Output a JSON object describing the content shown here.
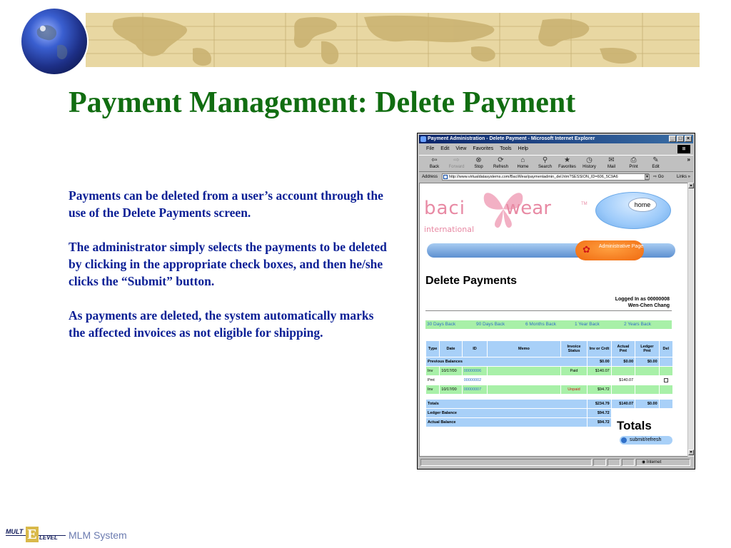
{
  "slide": {
    "title": "Payment Management: Delete Payment",
    "paragraphs": [
      "Payments can be deleted from a user’s account through the use of the Delete Payments screen.",
      "The administrator simply selects the payments to be deleted by clicking in the appropriate check boxes, and then he/she clicks the “Submit” button.",
      "As payments are deleted, the system automatically marks the affected invoices as not eligible for shipping."
    ],
    "footer_text": "MLM System",
    "logo": {
      "mult": "MULT",
      "e": "E",
      "level": "LEVEL"
    }
  },
  "browser": {
    "title": "Payment Administration - Delete Payment - Microsoft Internet Explorer",
    "menu": [
      "File",
      "Edit",
      "View",
      "Favorites",
      "Tools",
      "Help"
    ],
    "toolbar": [
      {
        "label": "Back",
        "icon": "back-arrow-icon",
        "enabled": true
      },
      {
        "label": "Forward",
        "icon": "forward-arrow-icon",
        "enabled": false
      },
      {
        "label": "Stop",
        "icon": "stop-icon",
        "enabled": true
      },
      {
        "label": "Refresh",
        "icon": "refresh-icon",
        "enabled": true
      },
      {
        "label": "Home",
        "icon": "home-icon",
        "enabled": true
      },
      {
        "label": "Search",
        "icon": "search-icon",
        "enabled": true
      },
      {
        "label": "Favorites",
        "icon": "favorites-icon",
        "enabled": true
      },
      {
        "label": "History",
        "icon": "history-icon",
        "enabled": true
      },
      {
        "label": "Mail",
        "icon": "mail-icon",
        "enabled": true
      },
      {
        "label": "Print",
        "icon": "print-icon",
        "enabled": true
      },
      {
        "label": "Edit",
        "icon": "edit-icon",
        "enabled": true
      }
    ],
    "address_label": "Address",
    "url": "http://www.virtualdatasystems.com/BaciWear/paymentadmin_del.htm?SESSION_ID=606_5C9A6",
    "go_label": "Go",
    "links_label": "Links",
    "status_zone": "Internet"
  },
  "page": {
    "brand_left": "baci",
    "brand_right": "wear",
    "brand_tm": "TM",
    "brand_sub": "international",
    "home_label": "home",
    "admin_label": "Administrative Page",
    "heading": "Delete Payments",
    "logged_in_line": "Logged In as 00000008",
    "user_name": "Wen-Chen Chang",
    "periods": [
      "30 Days Back",
      "90 Days Back",
      "6 Months Back",
      "1 Year Back",
      "2 Years Back"
    ],
    "table": {
      "headers": [
        "Type",
        "Date",
        "ID",
        "Memo",
        "Invoice Status",
        "Inv or Crdt",
        "Actual Pmt",
        "Ledger Pmt",
        "Del"
      ],
      "previous_balances": {
        "label": "Previous Balances",
        "inv": "$0.00",
        "actual": "$0.00",
        "ledger": "$0.00"
      },
      "rows": [
        {
          "type": "Inv",
          "date": "10/17/00",
          "id": "00000006",
          "memo": "",
          "status": "Paid",
          "inv": "$140.07",
          "actual": "",
          "ledger": "",
          "del": false
        },
        {
          "type": "Pmt",
          "date": "",
          "id": "00000002",
          "memo": "",
          "status": "",
          "inv": "",
          "actual": "$140.07",
          "ledger": "",
          "del": true
        },
        {
          "type": "Inv",
          "date": "10/17/00",
          "id": "00000007",
          "memo": "",
          "status": "Unpaid",
          "inv": "$94.72",
          "actual": "",
          "ledger": "",
          "del": false
        }
      ],
      "totals": {
        "label": "Totals",
        "inv": "$234.79",
        "actual": "$140.07",
        "ledger": "$0.00"
      },
      "ledger_balance": {
        "label": "Ledger Balance",
        "value": "$94.72"
      },
      "actual_balance": {
        "label": "Actual Balance",
        "value": "$94.72"
      }
    },
    "totals_big": "Totals",
    "submit_label": "submit/refresh"
  },
  "colors": {
    "title_green": "#116d11",
    "body_blue": "#0b1f95",
    "table_blue": "#a8d0f8",
    "table_green": "#a8f0a8",
    "brand_pink": "#e88aa4",
    "admin_orange": "#f06a10"
  }
}
